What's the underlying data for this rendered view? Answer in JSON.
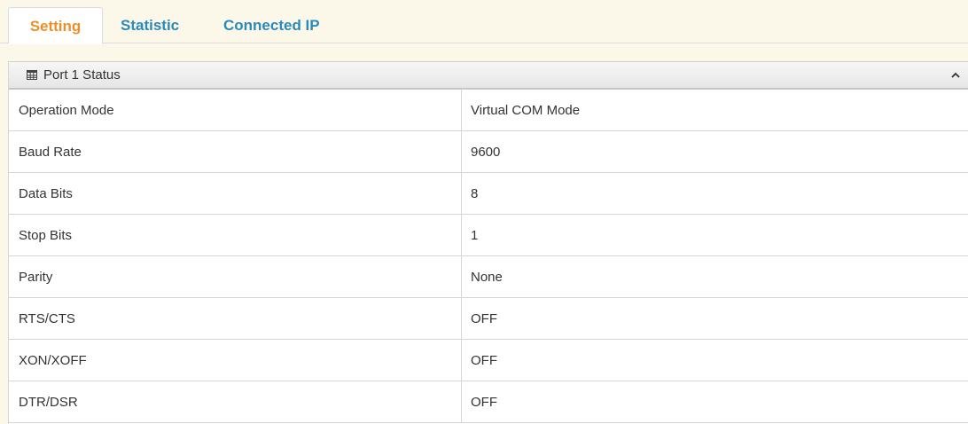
{
  "tabs": [
    {
      "label": "Setting",
      "active": true
    },
    {
      "label": "Statistic",
      "active": false
    },
    {
      "label": "Connected IP",
      "active": false
    }
  ],
  "panel": {
    "title": "Port 1 Status",
    "icon": "table-icon",
    "collapse_icon": "chevron-up-icon"
  },
  "rows": [
    {
      "label": "Operation Mode",
      "value": "Virtual COM Mode"
    },
    {
      "label": "Baud Rate",
      "value": "9600"
    },
    {
      "label": "Data Bits",
      "value": "8"
    },
    {
      "label": "Stop Bits",
      "value": "1"
    },
    {
      "label": "Parity",
      "value": "None"
    },
    {
      "label": "RTS/CTS",
      "value": "OFF"
    },
    {
      "label": "XON/XOFF",
      "value": "OFF"
    },
    {
      "label": "DTR/DSR",
      "value": "OFF"
    }
  ],
  "colors": {
    "active_tab": "#ec8f2b",
    "inactive_tab": "#2a8ab9",
    "page_background": "#fbf8ea"
  }
}
